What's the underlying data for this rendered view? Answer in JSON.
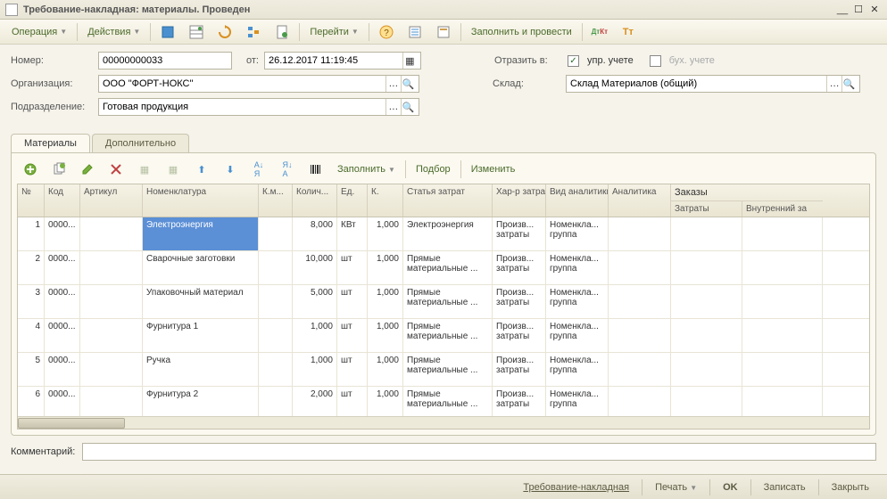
{
  "window": {
    "title": "Требование-накладная: материалы. Проведен"
  },
  "toolbar": {
    "operation": "Операция",
    "actions": "Действия",
    "goto": "Перейти",
    "fill_post": "Заполнить и провести"
  },
  "form": {
    "number_lbl": "Номер:",
    "number": "00000000033",
    "from_lbl": "от:",
    "date": "26.12.2017 11:19:45",
    "reflect_lbl": "Отразить в:",
    "mgmt": "упр. учете",
    "acct": "бух. учете",
    "org_lbl": "Организация:",
    "org": "ООО \"ФОРТ-НОКС\"",
    "wh_lbl": "Склад:",
    "wh": "Склад Материалов (общий)",
    "dept_lbl": "Подразделение:",
    "dept": "Готовая продукция"
  },
  "tabs": {
    "materials": "Материалы",
    "extra": "Дополнительно"
  },
  "rowtb": {
    "fill": "Заполнить",
    "select": "Подбор",
    "change": "Изменить"
  },
  "cols": {
    "n": "№",
    "code": "Код",
    "art": "Артикул",
    "nom": "Номенклатура",
    "km": "К.м...",
    "qty": "Колич...",
    "unit": "Ед.",
    "k": "К.",
    "cost": "Статья затрат",
    "char": "Хар-р затрат",
    "antype": "Вид аналитики",
    "analytics": "Аналитика",
    "orders": "Заказы",
    "costs": "Затраты",
    "inner": "Внутренний за"
  },
  "rows": [
    {
      "n": "1",
      "code": "0000...",
      "art": "",
      "nom": "Электроэнергия",
      "km": "",
      "qty": "8,000",
      "unit": "КВт",
      "k": "1,000",
      "cost": "Электроэнергия",
      "char": "Произв... затраты",
      "antype": "Номенкла... группа"
    },
    {
      "n": "2",
      "code": "0000...",
      "art": "",
      "nom": "Сварочные заготовки",
      "km": "",
      "qty": "10,000",
      "unit": "шт",
      "k": "1,000",
      "cost": "Прямые материальные ...",
      "char": "Произв... затраты",
      "antype": "Номенкла... группа"
    },
    {
      "n": "3",
      "code": "0000...",
      "art": "",
      "nom": "Упаковочный материал",
      "km": "",
      "qty": "5,000",
      "unit": "шт",
      "k": "1,000",
      "cost": "Прямые материальные ...",
      "char": "Произв... затраты",
      "antype": "Номенкла... группа"
    },
    {
      "n": "4",
      "code": "0000...",
      "art": "",
      "nom": "Фурнитура 1",
      "km": "",
      "qty": "1,000",
      "unit": "шт",
      "k": "1,000",
      "cost": "Прямые материальные ...",
      "char": "Произв... затраты",
      "antype": "Номенкла... группа"
    },
    {
      "n": "5",
      "code": "0000...",
      "art": "",
      "nom": "Ручка",
      "km": "",
      "qty": "1,000",
      "unit": "шт",
      "k": "1,000",
      "cost": "Прямые материальные ...",
      "char": "Произв... затраты",
      "antype": "Номенкла... группа"
    },
    {
      "n": "6",
      "code": "0000...",
      "art": "",
      "nom": "Фурнитура 2",
      "km": "",
      "qty": "2,000",
      "unit": "шт",
      "k": "1,000",
      "cost": "Прямые материальные ...",
      "char": "Произв... затраты",
      "antype": "Номенкла... группа"
    }
  ],
  "comment_lbl": "Комментарий:",
  "footer": {
    "req": "Требование-накладная",
    "print": "Печать",
    "ok": "OK",
    "save": "Записать",
    "close": "Закрыть"
  }
}
